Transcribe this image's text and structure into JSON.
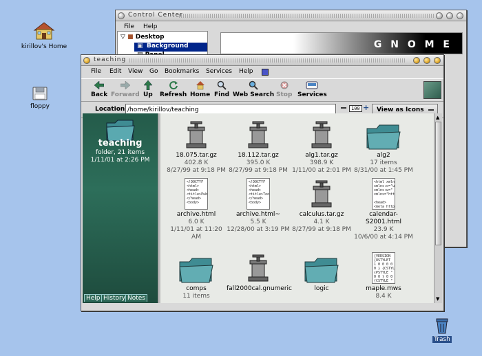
{
  "desktop": {
    "icons": [
      {
        "label": "kirillov's Home",
        "icon": "home-icon"
      },
      {
        "label": "floppy",
        "icon": "floppy-icon"
      },
      {
        "label": "Trash",
        "icon": "trash-icon"
      }
    ]
  },
  "control_center": {
    "title": "Control Center",
    "menu": [
      "File",
      "Help"
    ],
    "tree": [
      {
        "label": "Desktop"
      },
      {
        "label": "Background"
      },
      {
        "label": "Panel"
      }
    ],
    "banner": "G N O M E"
  },
  "nautilus": {
    "title": "teaching",
    "menu": [
      "File",
      "Edit",
      "View",
      "Go",
      "Bookmarks",
      "Services",
      "Help"
    ],
    "toolbar": [
      {
        "label": "Back",
        "icon": "back-arrow-icon",
        "enabled": true
      },
      {
        "label": "Forward",
        "icon": "forward-arrow-icon",
        "enabled": false
      },
      {
        "label": "Up",
        "icon": "up-arrow-icon",
        "enabled": true
      },
      {
        "label": "Refresh",
        "icon": "refresh-icon",
        "enabled": true
      },
      {
        "label": "Home",
        "icon": "home-icon",
        "enabled": true
      },
      {
        "label": "Find",
        "icon": "magnifier-icon",
        "enabled": true
      },
      {
        "label": "Web Search",
        "icon": "web-search-icon",
        "enabled": true
      },
      {
        "label": "Stop",
        "icon": "stop-icon",
        "enabled": false
      },
      {
        "label": "Services",
        "icon": "services-icon",
        "enabled": true
      }
    ],
    "location_label": "Location:",
    "location_value": "/home/kirillov/teaching",
    "zoom": "100",
    "view_mode": "View as Icons",
    "sidebar": {
      "folder_name": "teaching",
      "info": "folder, 21 items",
      "date": "1/11/01 at 2:26 PM",
      "tabs": [
        "Help",
        "History",
        "Notes"
      ]
    },
    "files": [
      {
        "name": "18.075.tar.gz",
        "size": "402.8 K",
        "date": "8/27/99 at 9:18 PM",
        "kind": "archive"
      },
      {
        "name": "18.112.tar.gz",
        "size": "395.0 K",
        "date": "8/27/99 at 9:18 PM",
        "kind": "archive"
      },
      {
        "name": "alg1.tar.gz",
        "size": "398.9 K",
        "date": "1/11/00 at 2:01 PM",
        "kind": "archive"
      },
      {
        "name": "alg2",
        "size": "17 items",
        "date": "8/31/00 at 1:45 PM",
        "kind": "folder"
      },
      {
        "name": "archive.html",
        "size": "6.0 K",
        "date": "1/11/01 at 11:20 AM",
        "kind": "html",
        "preview": "<!DOCTYF\n<html>\n<head>\n<title>Publ\n</head>\n<body>\n\n<h1>Publ"
      },
      {
        "name": "archive.html~",
        "size": "5.5 K",
        "date": "12/28/00 at 3:19 PM",
        "kind": "html",
        "preview": "<!DOCTYF\n<html>\n<head>\n<title>Tool\n</head>\n<body>\n\n<h1>Tool"
      },
      {
        "name": "calculus.tar.gz",
        "size": "4.1 K",
        "date": "8/27/99 at 9:18 PM",
        "kind": "archive"
      },
      {
        "name": "calendar-S2001.html",
        "size": "23.9 K",
        "date": "10/6/00 at 4:14 PM",
        "kind": "html",
        "preview": "<html xmln\nxmlns:o=\"u\nxmlns:w=\"\nxmlns=\"http\n\n<head>\n<meta http\n<meta nam"
      },
      {
        "name": "comps",
        "size": "11 items",
        "date": "",
        "kind": "folder"
      },
      {
        "name": "fall2000cal.gnumeric",
        "size": "",
        "date": "",
        "kind": "archive"
      },
      {
        "name": "logic",
        "size": "",
        "date": "",
        "kind": "folder"
      },
      {
        "name": "maple.mws",
        "size": "8.4 K",
        "date": "",
        "kind": "text",
        "preview": "{VERSION\n{USTYLET\n1 0 0 0 0 }{\n0 } {CSTYL\n{PSTYLE \"\n0 0 } 0 0 0 -\n{CSTYLE \""
      }
    ]
  },
  "colors": {
    "desktop": "#a6c4ec",
    "sidebar": "#2a6553",
    "selection": "#00258a"
  }
}
